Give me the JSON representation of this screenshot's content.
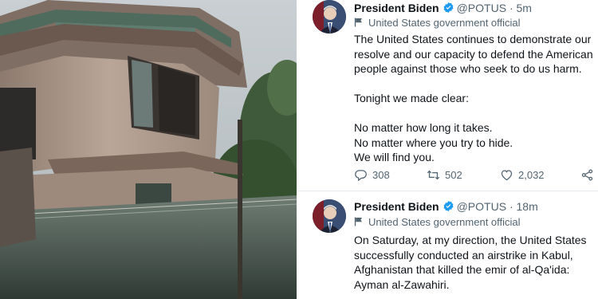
{
  "photo": {
    "subject_icon": "damaged-building-photo"
  },
  "colors": {
    "verified_badge": "#1d9bf0",
    "text_primary": "#0f1419",
    "text_secondary": "#536471",
    "divider": "#e6ecf0"
  },
  "tweets": [
    {
      "name": "President Biden",
      "handle": "@POTUS",
      "separator": "·",
      "time": "5m",
      "label": "United States government official",
      "lines": [
        "The United States continues to demonstrate our",
        "resolve and our capacity to defend the American",
        "people against those who seek to do us harm.",
        "",
        "Tonight we made clear:",
        "",
        "No matter how long it takes.",
        "No matter where you try to hide.",
        "We will find you."
      ],
      "stats": {
        "replies": "308",
        "retweets": "502",
        "likes": "2,032"
      },
      "icons": [
        "reply-icon",
        "retweet-icon",
        "like-icon",
        "share-icon"
      ]
    },
    {
      "name": "President Biden",
      "handle": "@POTUS",
      "separator": "·",
      "time": "18m",
      "label": "United States government official",
      "lines": [
        "On Saturday, at my direction, the United States",
        "successfully conducted an airstrike in Kabul,",
        "Afghanistan that killed the emir of al-Qa'ida:",
        "Ayman al-Zawahiri."
      ]
    }
  ]
}
